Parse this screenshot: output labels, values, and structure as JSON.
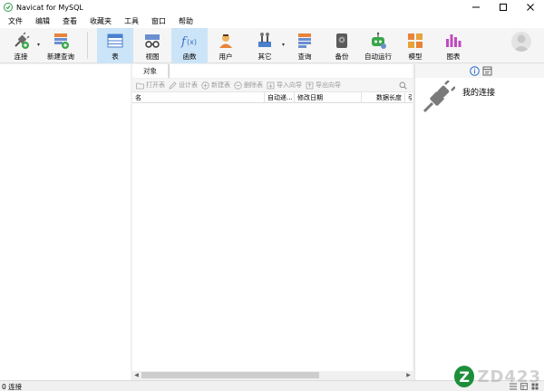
{
  "window": {
    "title": "Navicat for MySQL"
  },
  "menu": [
    "文件",
    "编辑",
    "查看",
    "收藏夹",
    "工具",
    "窗口",
    "帮助"
  ],
  "toolbar": {
    "connect": "连接",
    "new_query": "新建查询",
    "table": "表",
    "view": "视图",
    "function": "函数",
    "user": "用户",
    "other": "其它",
    "query": "查询",
    "backup": "备份",
    "auto_run": "自动运行",
    "model": "模型",
    "chart": "图表"
  },
  "tabs": {
    "object": "对象"
  },
  "object_toolbar": {
    "open_table": "打开表",
    "design_table": "设计表",
    "new_table": "新建表",
    "delete_table": "删除表",
    "import_wizard": "导入向导",
    "export_wizard": "导出向导"
  },
  "columns": [
    "名",
    "自动递...",
    "修改日期",
    "数据长度",
    "引"
  ],
  "info_pane": {
    "title": "我的连接"
  },
  "status": {
    "connections": "0 连接"
  },
  "watermark": {
    "badge": "Z",
    "text": "ZD423"
  },
  "colors": {
    "accent": "#cce4f7",
    "nav_bg": "#ffffff",
    "statusbar_bg": "#f0f0f0"
  }
}
